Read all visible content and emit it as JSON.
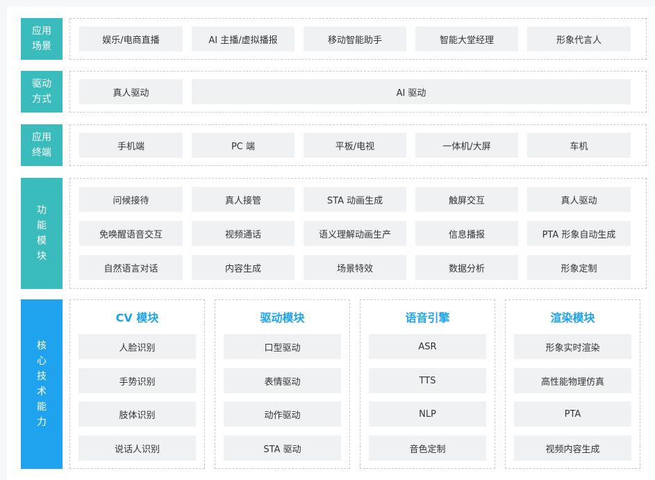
{
  "scenarios": {
    "label": [
      "应用",
      "场景"
    ],
    "items": [
      "娱乐/电商直播",
      "AI 主播/虚拟播报",
      "移动智能助手",
      "智能大堂经理",
      "形象代言人"
    ]
  },
  "drive": {
    "label": [
      "驱动",
      "方式"
    ],
    "items": [
      "真人驱动",
      "AI 驱动"
    ]
  },
  "terminals": {
    "label": [
      "应用",
      "终端"
    ],
    "items": [
      "手机端",
      "PC 端",
      "平板/电视",
      "一体机/大屏",
      "车机"
    ]
  },
  "functions": {
    "label": [
      "功",
      "能",
      "模",
      "块"
    ],
    "rows": [
      [
        "问候接待",
        "真人接管",
        "STA 动画生成",
        "触屏交互",
        "真人驱动"
      ],
      [
        "免唤醒语音交互",
        "视频通话",
        "语义理解动画生产",
        "信息播报",
        "PTA 形象自动生成"
      ],
      [
        "自然语言对话",
        "内容生成",
        "场景特效",
        "数据分析",
        "形象定制"
      ]
    ]
  },
  "core": {
    "label": [
      "核",
      "心",
      "技",
      "术",
      "能",
      "力"
    ],
    "columns": [
      {
        "title": "CV 模块",
        "items": [
          "人脸识别",
          "手势识别",
          "肢体识别",
          "说话人识别"
        ]
      },
      {
        "title": "驱动模块",
        "items": [
          "口型驱动",
          "表情驱动",
          "动作驱动",
          "STA 驱动"
        ]
      },
      {
        "title": "语音引擎",
        "items": [
          "ASR",
          "TTS",
          "NLP",
          "音色定制"
        ]
      },
      {
        "title": "渲染模块",
        "items": [
          "形象实时渲染",
          "高性能物理仿真",
          "PTA",
          "视频内容生成"
        ]
      }
    ]
  },
  "colors": {
    "teal_label": "#3abcbc",
    "blue_label": "#1fa3ee",
    "chip_bg": "#f0f1f3",
    "accent_title": "#1fa3ee"
  }
}
